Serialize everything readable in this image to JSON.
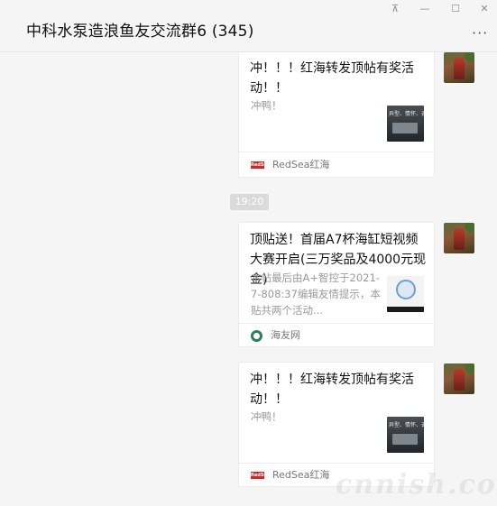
{
  "window": {
    "title": "中科水泵造浪鱼友交流群6 (345)",
    "controls": {
      "pin": "⊼",
      "minimize": "—",
      "maximize": "☐",
      "close": "✕"
    },
    "more": "···"
  },
  "messages": [
    {
      "title": "冲！！！红海转发顶帖有奖活动！！",
      "desc": "冲鸭！",
      "thumb_text": "异型、情怀、调板",
      "source_badge": "RedSea",
      "source": "RedSea红海"
    },
    {
      "title": "顶贴送！首届A7杯海缸短视频大赛开启(三万奖品及4000元现金)",
      "desc": "本帖最后由A+智控于2021-7-808:37编辑友情提示，本贴共两个活动...",
      "source": "海友网"
    },
    {
      "title": "冲！！！红海转发顶帖有奖活动！！",
      "desc": "冲鸭！",
      "thumb_text": "异型、情怀、调板",
      "source_badge": "RedSea",
      "source": "RedSea红海"
    }
  ],
  "timestamp": "19:20",
  "watermark": "cnnish.com"
}
